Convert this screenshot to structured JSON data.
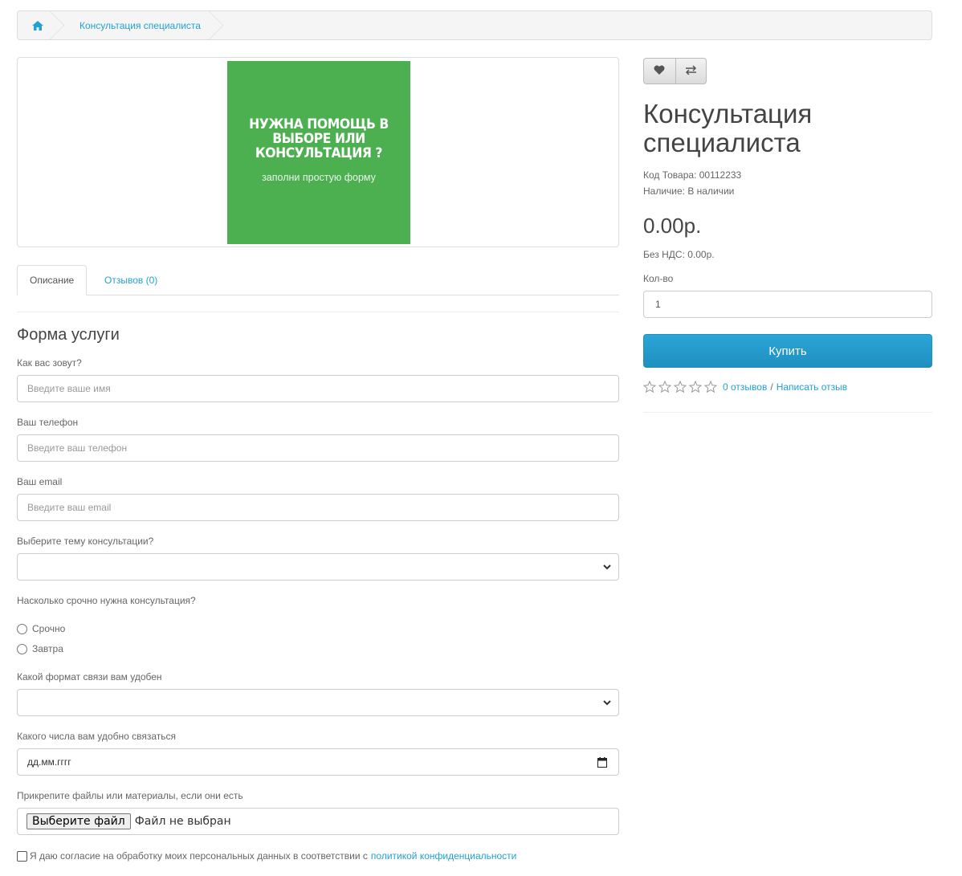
{
  "breadcrumb": {
    "home_icon": "home-icon",
    "item": "Консультация специалиста"
  },
  "promo": {
    "title": "НУЖНА ПОМОЩЬ В ВЫБОРЕ ИЛИ КОНСУЛЬТАЦИЯ ?",
    "subtitle": "заполни простую форму",
    "background": "#4caf50"
  },
  "tabs": [
    {
      "label": "Описание",
      "active": true
    },
    {
      "label": "Отзывов (0)",
      "active": false
    }
  ],
  "form": {
    "title": "Форма услуги",
    "name_label": "Как вас зовут?",
    "name_placeholder": "Введите ваше имя",
    "phone_label": "Ваш телефон",
    "phone_placeholder": "Введите ваш телефон",
    "email_label": "Ваш email",
    "email_placeholder": "Введите ваш email",
    "topic_label": "Выберите тему консультации?",
    "topic_value": "",
    "urgency_label": "Насколько срочно нужна консультация?",
    "urgency_options": [
      "Срочно",
      "Завтра"
    ],
    "format_label": "Какой формат связи вам удобен",
    "format_value": "",
    "date_label": "Какого числа вам удобно связаться",
    "date_placeholder": "дд.мм.гггг",
    "files_label": "Прикрепите файлы или материалы, если они есть",
    "file_button": "Выберите файл",
    "file_status": "Файл не выбран",
    "consent_text": "Я даю согласие на обработку моих персональных данных в соответствии с",
    "consent_link": "политикой конфиденциальности"
  },
  "product": {
    "wishlist_icon": "heart-icon",
    "compare_icon": "exchange-icon",
    "title": "Консультация специалиста",
    "code": "Код Товара: 00112233",
    "availability": "Наличие: В наличии",
    "price": "0.00р.",
    "price_ex_tax": "Без НДС: 0.00р.",
    "qty_label": "Кол-во",
    "qty_value": "1",
    "buy_label": "Купить",
    "rating": 0,
    "reviews_link": "0 отзывов",
    "separator": "/",
    "write_review": "Написать отзыв"
  },
  "colors": {
    "link": "#23a1d1",
    "buy_button": "#229ac8"
  }
}
